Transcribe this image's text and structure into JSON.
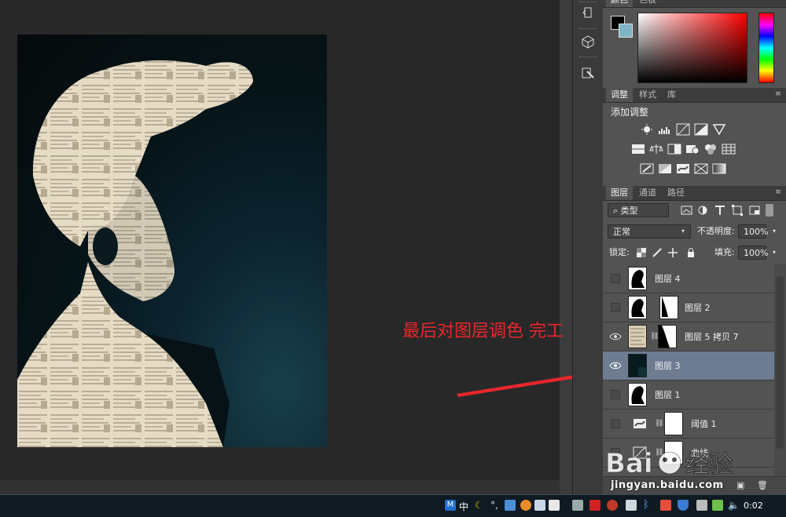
{
  "color_panel": {
    "tabs": [
      {
        "label": "颜色"
      },
      {
        "label": "色板"
      }
    ],
    "foreground_color": "#000000",
    "background_color": "#7fb4c6"
  },
  "adjustments_panel": {
    "tabs": [
      {
        "label": "调整"
      },
      {
        "label": "样式"
      },
      {
        "label": "库"
      }
    ],
    "title": "添加调整",
    "icons_row1": [
      "brightness-contrast-icon",
      "levels-icon",
      "curves-icon",
      "exposure-icon",
      "vibrance-icon"
    ],
    "icons_row2": [
      "hue-saturation-icon",
      "color-balance-icon",
      "black-white-icon",
      "photo-filter-icon",
      "channel-mixer-icon",
      "color-lookup-icon"
    ],
    "icons_row3": [
      "invert-icon",
      "posterize-icon",
      "threshold-icon",
      "selective-color-icon",
      "gradient-map-icon"
    ]
  },
  "layers_panel": {
    "tabs": [
      {
        "label": "图层"
      },
      {
        "label": "通道"
      },
      {
        "label": "路径"
      }
    ],
    "filter_kind": "类型",
    "blend_mode": "正常",
    "opacity_label": "不透明度:",
    "opacity_value": "100%",
    "lock_label": "锁定:",
    "fill_label": "填充:",
    "fill_value": "100%",
    "layers": [
      {
        "name": "图层 4",
        "visible": false,
        "selected": false,
        "has_mask": false
      },
      {
        "name": "图层 2",
        "visible": false,
        "selected": false,
        "has_mask": true
      },
      {
        "name": "图层 5 拷贝 7",
        "visible": true,
        "selected": false,
        "has_mask": true
      },
      {
        "name": "图层 3",
        "visible": true,
        "selected": true,
        "has_mask": false
      },
      {
        "name": "图层 1",
        "visible": false,
        "selected": false,
        "has_mask": false
      },
      {
        "name": "阈值 1",
        "visible": false,
        "selected": false,
        "has_mask": true
      },
      {
        "name": "曲线",
        "visible": false,
        "selected": false,
        "has_mask": true
      }
    ]
  },
  "annotation": {
    "text": "最后对图层调色 完工",
    "color": "#e8262c"
  },
  "taskbar": {
    "ime_label": "中",
    "clock": "0:02"
  },
  "watermark": {
    "brand": "Bai 经验",
    "url": "jingyan.baidu.com"
  }
}
